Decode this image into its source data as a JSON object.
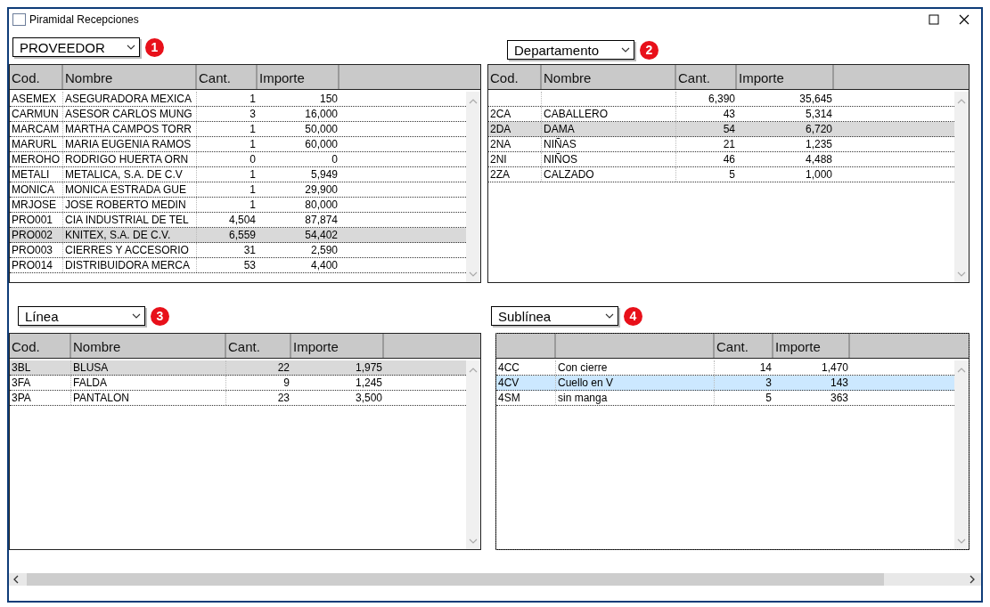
{
  "window": {
    "title": "Piramidal Recepciones"
  },
  "panels": [
    {
      "dropdown": {
        "value": "PROVEEDOR"
      },
      "badge": "1",
      "focused": false,
      "columns": [
        {
          "label": "Cod."
        },
        {
          "label": "Nombre"
        },
        {
          "label": "Cant."
        },
        {
          "label": "Importe"
        }
      ],
      "rows": [
        {
          "cod": "ASEMEX",
          "nombre": "ASEGURADORA MEXICA",
          "cant": "1",
          "importe": "150",
          "selected": false
        },
        {
          "cod": "CARMUN",
          "nombre": "ASESOR CARLOS MUNG",
          "cant": "3",
          "importe": "16,000",
          "selected": false
        },
        {
          "cod": "MARCAM",
          "nombre": "MARTHA CAMPOS TORR",
          "cant": "1",
          "importe": "50,000",
          "selected": false
        },
        {
          "cod": "MARURL",
          "nombre": "MARIA EUGENIA RAMOS",
          "cant": "1",
          "importe": "60,000",
          "selected": false
        },
        {
          "cod": "MEROHO",
          "nombre": "RODRIGO HUERTA ORN",
          "cant": "0",
          "importe": "0",
          "selected": false
        },
        {
          "cod": "METALI",
          "nombre": "METALICA, S.A. DE C.V",
          "cant": "1",
          "importe": "5,949",
          "selected": false
        },
        {
          "cod": "MONICA",
          "nombre": "MONICA ESTRADA GUE",
          "cant": "1",
          "importe": "29,900",
          "selected": false
        },
        {
          "cod": "MRJOSE",
          "nombre": "JOSE ROBERTO MEDIN",
          "cant": "1",
          "importe": "80,000",
          "selected": false
        },
        {
          "cod": "PRO001",
          "nombre": "CIA INDUSTRIAL DE TEL",
          "cant": "4,504",
          "importe": "87,874",
          "selected": false
        },
        {
          "cod": "PRO002",
          "nombre": "KNITEX, S.A. DE C.V.",
          "cant": "6,559",
          "importe": "54,402",
          "selected": true
        },
        {
          "cod": "PRO003",
          "nombre": "CIERRES Y ACCESORIO",
          "cant": "31",
          "importe": "2,590",
          "selected": false
        },
        {
          "cod": "PRO014",
          "nombre": "DISTRIBUIDORA MERCA",
          "cant": "53",
          "importe": "4,400",
          "selected": false
        }
      ]
    },
    {
      "dropdown": {
        "value": "Departamento"
      },
      "badge": "2",
      "focused": false,
      "columns": [
        {
          "label": "Cod."
        },
        {
          "label": "Nombre"
        },
        {
          "label": "Cant."
        },
        {
          "label": "Importe"
        }
      ],
      "rows": [
        {
          "cant": "6,390",
          "importe": "35,645",
          "selected": false
        },
        {
          "cod": "2CA",
          "nombre": "CABALLERO",
          "cant": "43",
          "importe": "5,314",
          "selected": false
        },
        {
          "cod": "2DA",
          "nombre": "DAMA",
          "cant": "54",
          "importe": "6,720",
          "selected": true
        },
        {
          "cod": "2NA",
          "nombre": "NIÑAS",
          "cant": "21",
          "importe": "1,235",
          "selected": false
        },
        {
          "cod": "2NI",
          "nombre": "NIÑOS",
          "cant": "46",
          "importe": "4,488",
          "selected": false
        },
        {
          "cod": "2ZA",
          "nombre": "CALZADO",
          "cant": "5",
          "importe": "1,000",
          "selected": false
        }
      ]
    },
    {
      "dropdown": {
        "value": "Línea"
      },
      "badge": "3",
      "focused": false,
      "columns": [
        {
          "label": "Cod."
        },
        {
          "label": "Nombre"
        },
        {
          "label": "Cant."
        },
        {
          "label": "Importe"
        }
      ],
      "rows": [
        {
          "cod": "3BL",
          "nombre": "BLUSA",
          "cant": "22",
          "importe": "1,975",
          "selected": true
        },
        {
          "cod": "3FA",
          "nombre": "FALDA",
          "cant": "9",
          "importe": "1,245",
          "selected": false
        },
        {
          "cod": "3PA",
          "nombre": "PANTALON",
          "cant": "23",
          "importe": "3,500",
          "selected": false
        }
      ]
    },
    {
      "dropdown": {
        "value": "Sublínea"
      },
      "badge": "4",
      "focused": true,
      "columns": [
        {},
        {},
        {
          "label": "Cant."
        },
        {
          "label": "Importe"
        }
      ],
      "rows": [
        {
          "cod": "4CC",
          "nombre": "Con cierre",
          "cant": "14",
          "importe": "1,470",
          "selected": false
        },
        {
          "cod": "4CV",
          "nombre": "Cuello en V",
          "cant": "3",
          "importe": "143",
          "selected": true
        },
        {
          "cod": "4SM",
          "nombre": "sin manga",
          "cant": "5",
          "importe": "363",
          "selected": false
        }
      ]
    }
  ]
}
